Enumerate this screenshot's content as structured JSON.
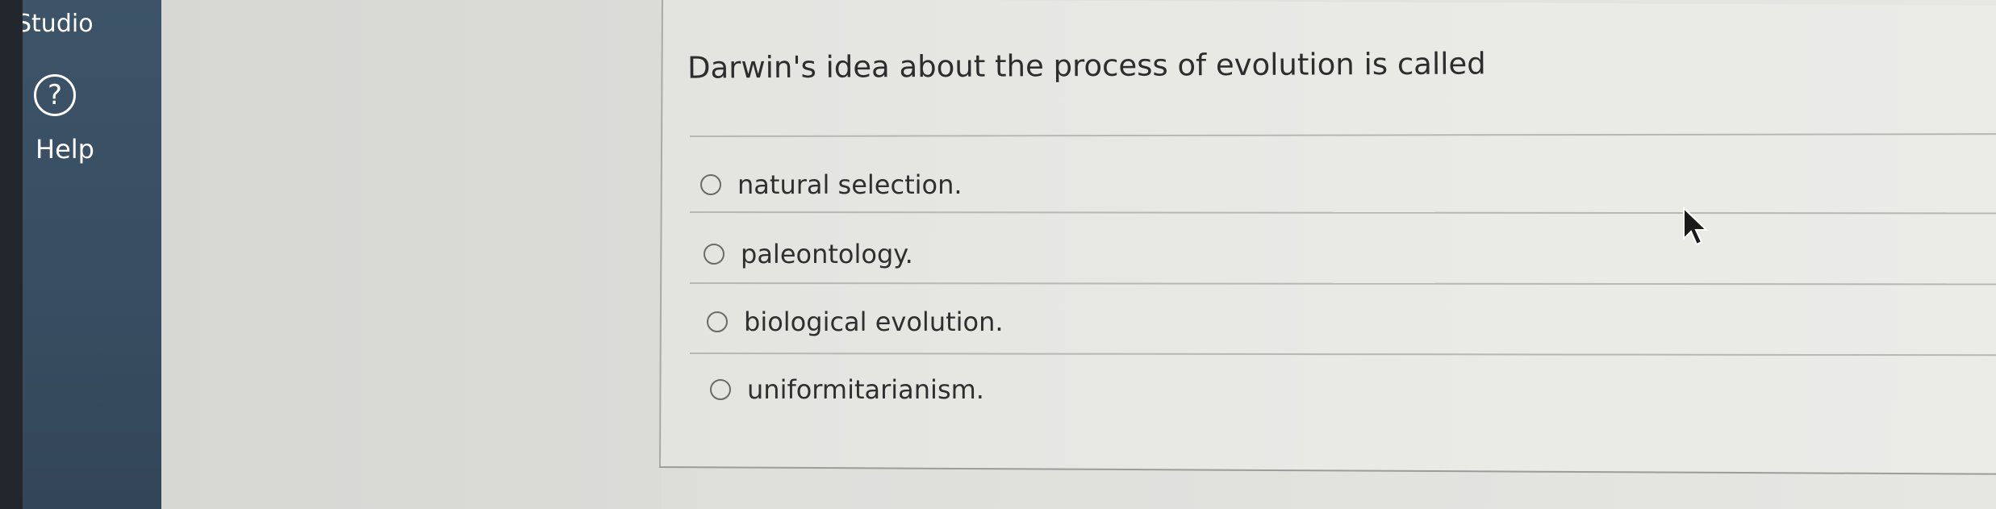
{
  "sidebar": {
    "studio_label": "Studio",
    "help_label": "Help",
    "help_icon_glyph": "?"
  },
  "question": {
    "text": "Darwin's idea about the process of evolution is called",
    "options": [
      {
        "label": "natural selection.",
        "selected": false
      },
      {
        "label": "paleontology.",
        "selected": false
      },
      {
        "label": "biological evolution.",
        "selected": false
      },
      {
        "label": "uniformitarianism.",
        "selected": false
      }
    ]
  },
  "colors": {
    "sidebar": "#3a5065",
    "background": "#dcdcd9",
    "text": "#2d2d2d"
  },
  "icons": {
    "help": "question-circle-icon",
    "pointer": "mouse-pointer-icon"
  }
}
